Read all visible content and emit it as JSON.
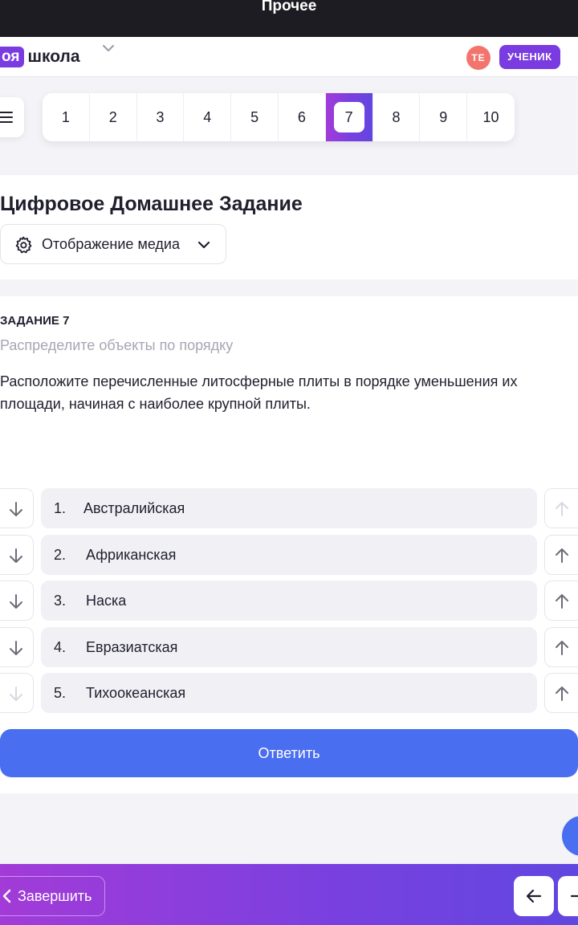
{
  "topbar": {
    "title": "Прочее"
  },
  "header": {
    "logo_badge": "оя",
    "logo_text": "школа",
    "avatar_initials": "ТЕ",
    "role_badge": "УЧЕНИК"
  },
  "pager": {
    "pages": [
      "1",
      "2",
      "3",
      "4",
      "5",
      "6",
      "7",
      "8",
      "9",
      "10"
    ],
    "active": "7"
  },
  "homework": {
    "title": "Цифровое Домашнее Задание",
    "media_button": "Отображение медиа"
  },
  "task": {
    "number_label": "ЗАДАНИЕ 7",
    "instruction": "Распределите объекты по порядку",
    "text": "Расположите перечисленные литосферные плиты в порядке уменьшения их площади, начиная с наиболее крупной плиты.",
    "items": [
      {
        "num": "1.",
        "label": "Австралийская"
      },
      {
        "num": "2.",
        "label": "Африканская"
      },
      {
        "num": "3.",
        "label": "Наска"
      },
      {
        "num": "4.",
        "label": "Евразиатская"
      },
      {
        "num": "5.",
        "label": "Тихоокеанская"
      }
    ],
    "submit_label": "Ответить"
  },
  "footer": {
    "finish_label": "Завершить"
  },
  "colors": {
    "accent": "#7a3ce0",
    "primary_button": "#4a6ef0",
    "avatar": "#f2746d"
  },
  "icons": [
    "menu-icon",
    "chevron-down-icon",
    "gear-icon",
    "arrow-down-icon",
    "arrow-up-icon",
    "chevron-left-icon",
    "arrow-left-icon",
    "arrow-right-icon"
  ]
}
